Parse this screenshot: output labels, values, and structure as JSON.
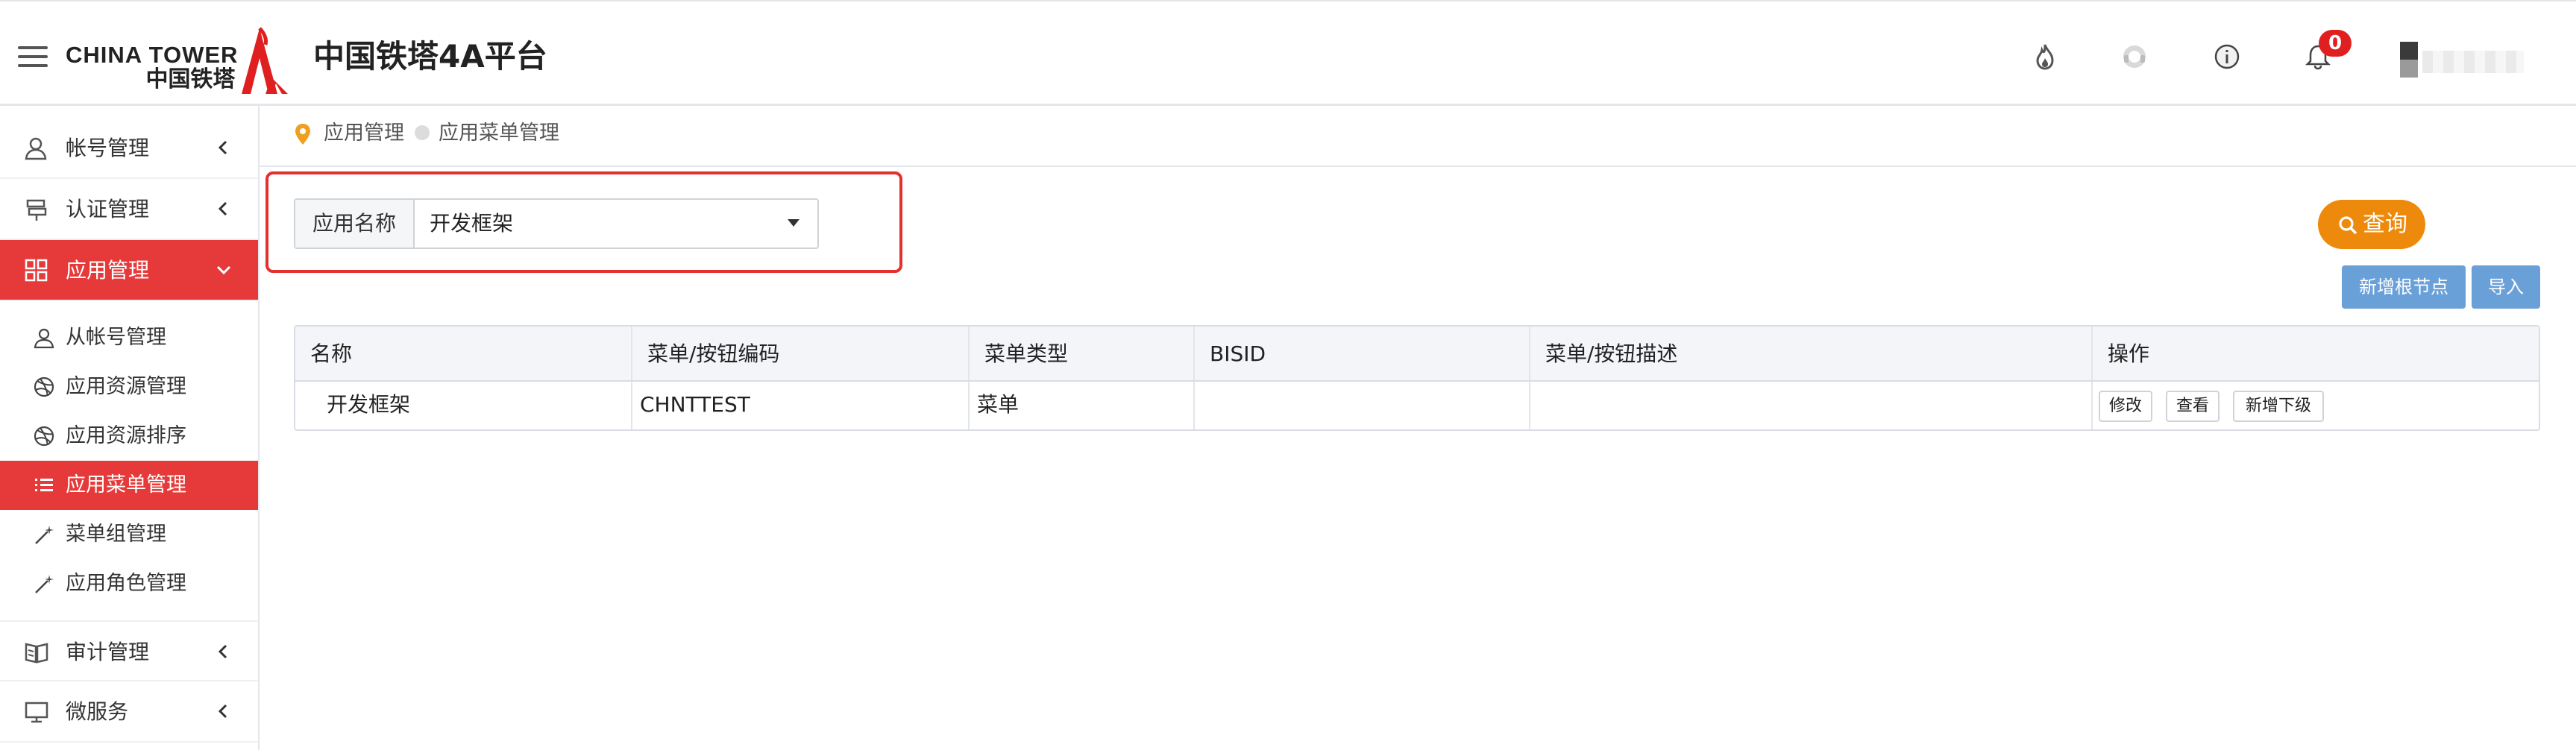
{
  "header": {
    "logo_en": "CHINA TOWER",
    "logo_cn": "中国铁塔",
    "app_title": "中国铁塔4A平台",
    "notification_count": "0",
    "brand_color": "#e02020"
  },
  "sidebar": {
    "items": [
      {
        "label": "帐号管理",
        "icon": "user-account-icon"
      },
      {
        "label": "认证管理",
        "icon": "signpost-icon"
      },
      {
        "label": "应用管理",
        "icon": "grid-icon",
        "expanded": true
      },
      {
        "label": "审计管理",
        "icon": "book-icon"
      },
      {
        "label": "微服务",
        "icon": "monitor-icon"
      }
    ],
    "sub_items": [
      {
        "label": "从帐号管理",
        "icon": "user-icon"
      },
      {
        "label": "应用资源管理",
        "icon": "dribbble-icon"
      },
      {
        "label": "应用资源排序",
        "icon": "dribbble-icon"
      },
      {
        "label": "应用菜单管理",
        "icon": "list-icon",
        "active": true
      },
      {
        "label": "菜单组管理",
        "icon": "magic-wand-icon"
      },
      {
        "label": "应用角色管理",
        "icon": "magic-wand-icon"
      }
    ],
    "active_color": "#e63a3a"
  },
  "breadcrumb": {
    "level1": "应用管理",
    "level2": "应用菜单管理"
  },
  "filter": {
    "label": "应用名称",
    "selected": "开发框架"
  },
  "buttons": {
    "query": "查询",
    "add_root": "新增根节点",
    "import": "导入"
  },
  "table": {
    "headers": [
      "名称",
      "菜单/按钮编码",
      "菜单类型",
      "BISID",
      "菜单/按钮描述",
      "操作"
    ],
    "rows": [
      {
        "name": "开发框架",
        "code": "CHNTTEST",
        "type": "菜单",
        "bisid": "",
        "desc": ""
      }
    ],
    "ops": [
      "修改",
      "查看",
      "新增下级"
    ]
  }
}
